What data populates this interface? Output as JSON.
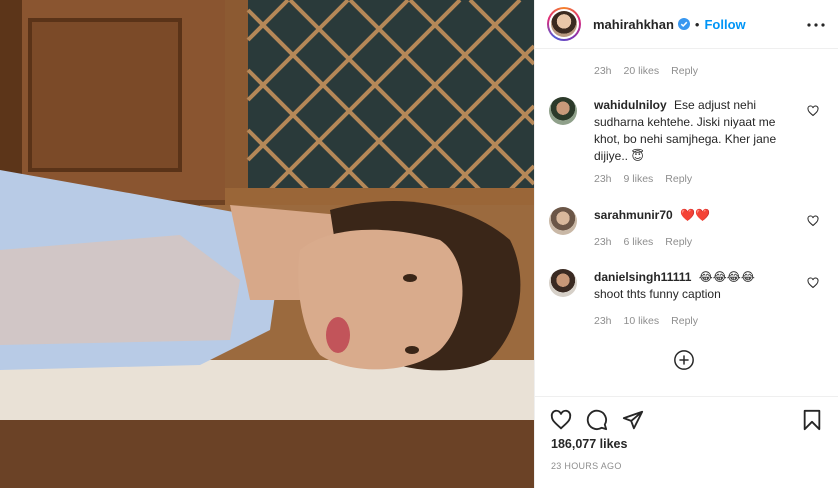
{
  "post_header": {
    "username": "mahirahkhan",
    "separator": "•",
    "follow_label": "Follow"
  },
  "first_comment_meta": {
    "time": "23h",
    "likes": "20 likes",
    "reply": "Reply"
  },
  "comments": [
    {
      "user": "wahidulniloy",
      "text": "Ese adjust nehi sudharna kehtehe. Jiski niyaat me khot, bo nehi samjhega. Kher jane dijiye..",
      "emoji": "😇",
      "time": "23h",
      "likes": "9 likes",
      "reply": "Reply"
    },
    {
      "user": "sarahmunir70",
      "text": "",
      "emoji": "❤️❤️",
      "time": "23h",
      "likes": "6 likes",
      "reply": "Reply"
    },
    {
      "user": "danielsingh11111",
      "text": "shoot thts funny caption",
      "emoji": "😂😂😂😂",
      "time": "23h",
      "likes": "10 likes",
      "reply": "Reply"
    }
  ],
  "footer": {
    "likes": "186,077 likes",
    "timestamp": "23 HOURS AGO"
  },
  "icons": {
    "more": "more-options-icon",
    "heart": "heart-icon",
    "comment": "comment-icon",
    "share": "share-icon",
    "save": "bookmark-icon",
    "add": "add-circle-icon",
    "verified": "verified-badge-icon"
  },
  "colors": {
    "accent": "#0095f6",
    "muted": "#8e8e8e",
    "text": "#262626"
  }
}
